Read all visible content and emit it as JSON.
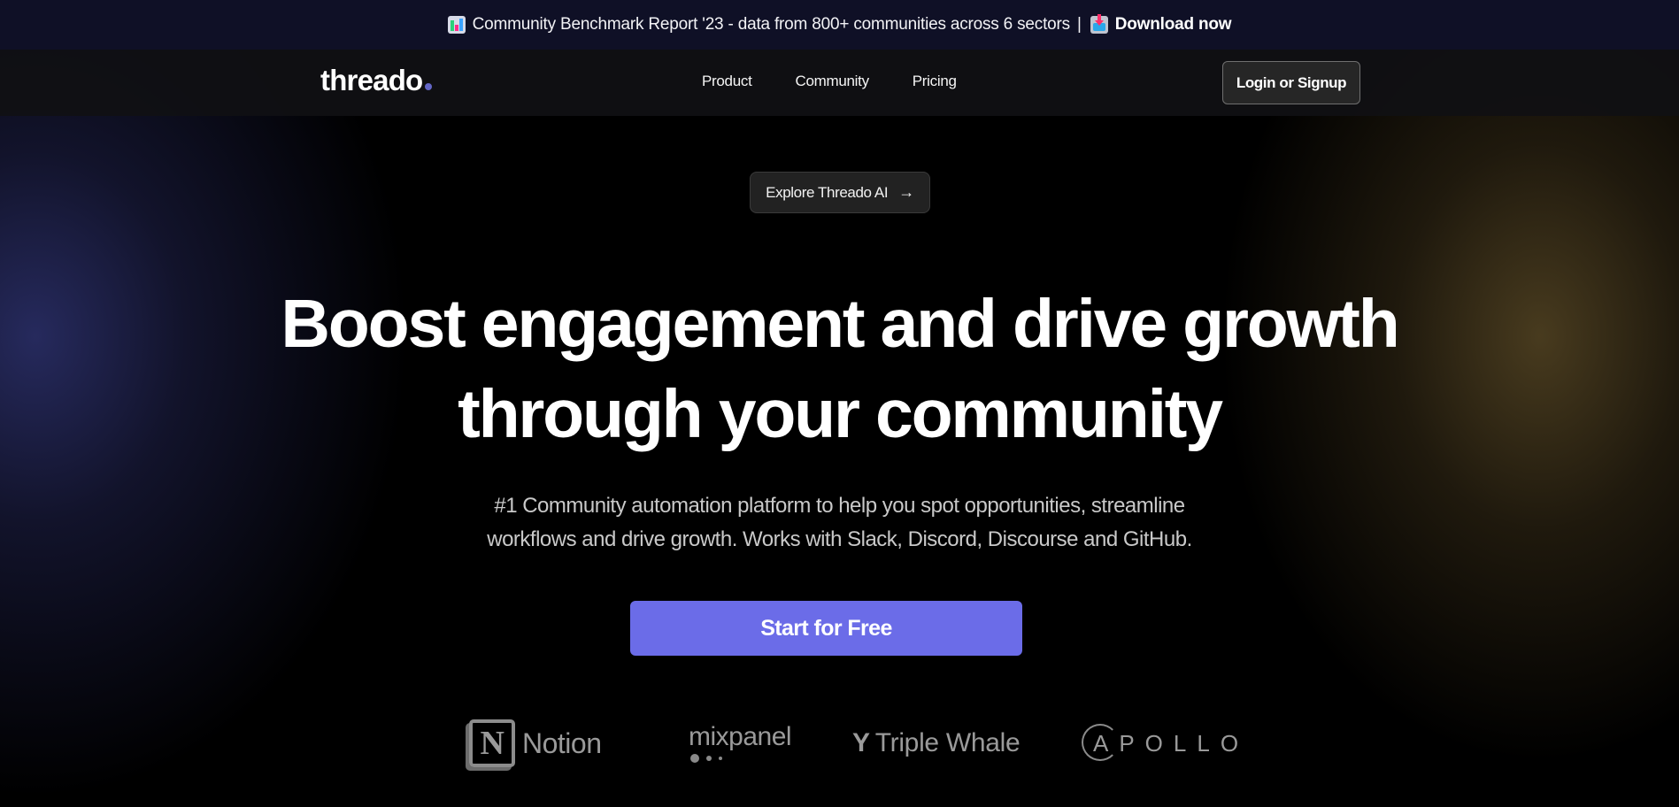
{
  "banner": {
    "left_icon": "bar-chart-emoji-icon",
    "text": "Community Benchmark Report '23 - data from 800+ communities across 6 sectors",
    "separator": "|",
    "cta_icon": "inbox-download-emoji-icon",
    "cta_label": "Download now"
  },
  "nav": {
    "logo": "threado",
    "links": [
      {
        "label": "Product"
      },
      {
        "label": "Community"
      },
      {
        "label": "Pricing"
      }
    ],
    "login_label": "Login or Signup"
  },
  "hero": {
    "explore_label": "Explore Threado AI",
    "explore_icon": "→",
    "headline_line1": "Boost engagement and drive growth",
    "headline_line2": "through your community",
    "subtitle_line1": "#1 Community automation platform to help you spot opportunities, streamline",
    "subtitle_line2": "workflows and drive growth. Works with Slack, Discord, Discourse and GitHub.",
    "cta_label": "Start for Free"
  },
  "customers": [
    {
      "name": "Notion",
      "mark": "N"
    },
    {
      "name": "mixpanel"
    },
    {
      "name": "Triple Whale",
      "mark": "Y"
    },
    {
      "name": "APOLLO",
      "mark": "A",
      "rest": "POLLO"
    }
  ],
  "colors": {
    "banner_bg": "#0f1026",
    "accent": "#6b6ce8",
    "logo_dot": "#6366c6",
    "page_bg": "#000000"
  }
}
